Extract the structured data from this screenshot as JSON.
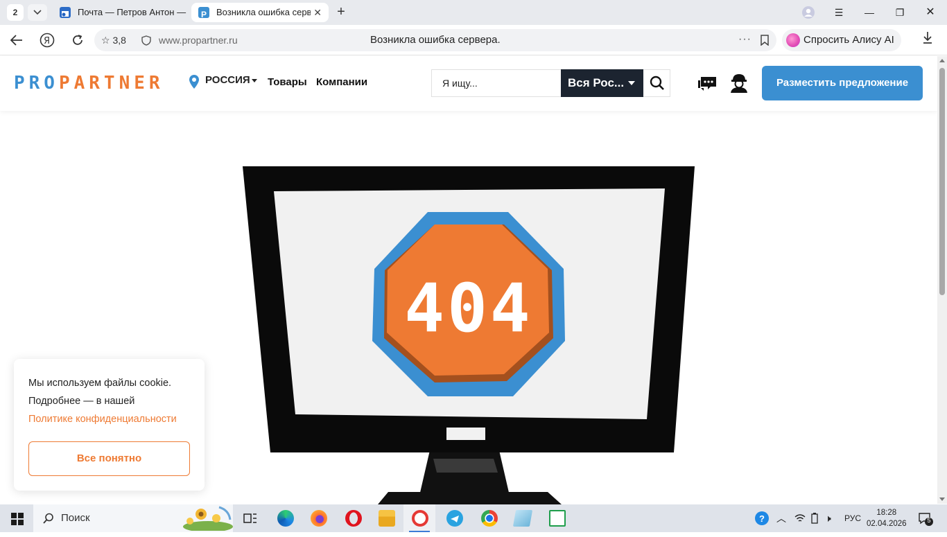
{
  "browser": {
    "tab_count": "2",
    "tabs": [
      {
        "title": "Почта — Петров Антон —",
        "favicon": "mail-icon"
      },
      {
        "title": "Возникла ошибка сервера.",
        "favicon": "propartner-favicon",
        "active": true
      }
    ],
    "new_tab_label": "+",
    "rating": "3,8",
    "url": "www.propartner.ru",
    "page_title": "Возникла ошибка сервера.",
    "alice_label": "Спросить Алису AI"
  },
  "site": {
    "logo_pro": "PRO",
    "logo_partner": "PARTNER",
    "region": "РОССИЯ",
    "nav": [
      {
        "label": "Товары"
      },
      {
        "label": "Компании"
      }
    ],
    "search": {
      "placeholder": "Я ищу...",
      "region_select": "Вся Рос..."
    },
    "cta_label": "Разместить предложение"
  },
  "error": {
    "code": "404"
  },
  "cookie": {
    "line1": "Мы используем файлы cookie.",
    "line2": "Подробнее — в нашей",
    "link": "Политике конфиденциальности",
    "button": "Все понятно"
  },
  "taskbar": {
    "search_label": "Поиск",
    "apps": [
      "task-view-icon",
      "edge-icon",
      "firefox-icon",
      "opera-icon",
      "file-explorer-icon",
      "yandex-browser-icon",
      "telegram-icon",
      "chrome-icon",
      "notes-icon",
      "spreadsheet-icon"
    ],
    "language": "РУС",
    "time": "18:28",
    "date": "02.04.2026",
    "notifications": "5"
  },
  "colors": {
    "brand_blue": "#3b8fd1",
    "brand_orange": "#ee7a33",
    "dark": "#1c2430"
  }
}
